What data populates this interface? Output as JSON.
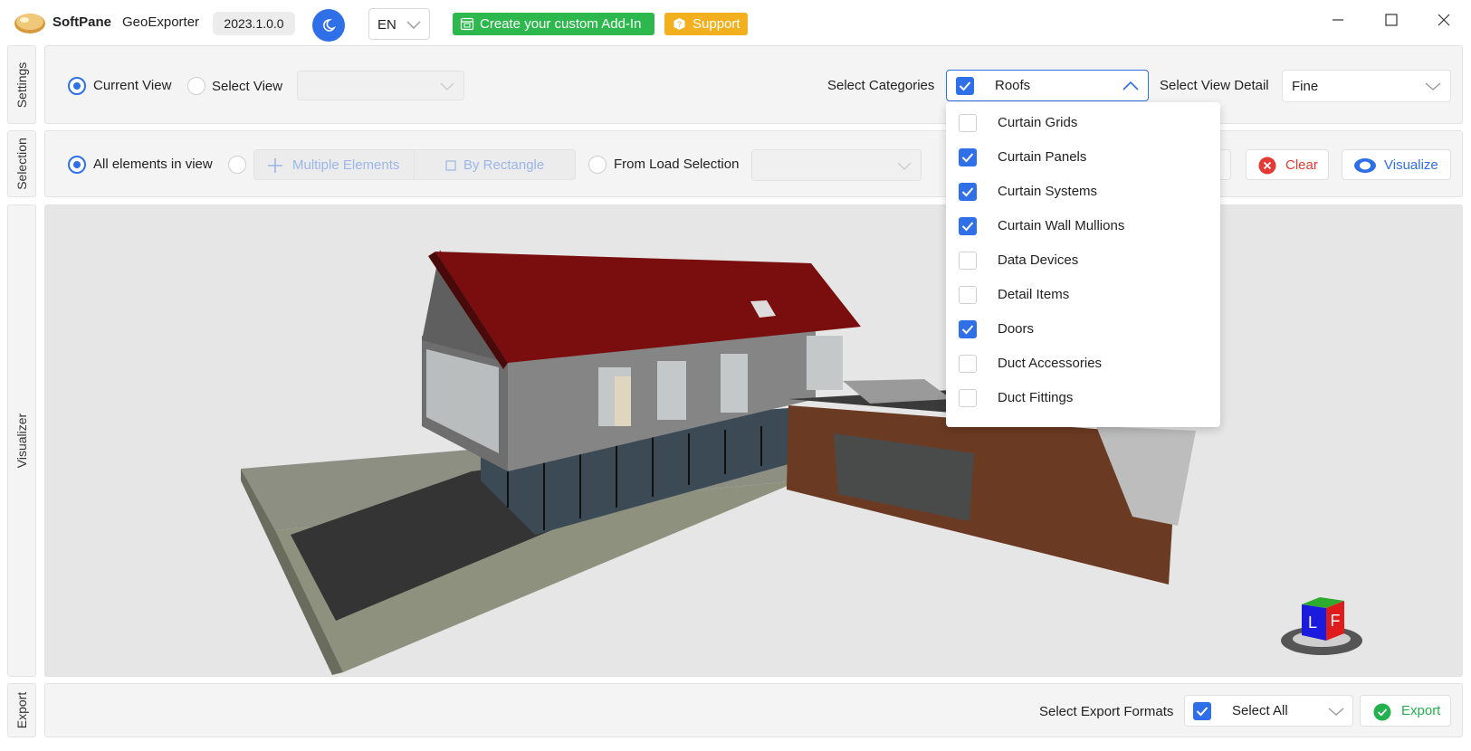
{
  "titlebar": {
    "brand": "SoftPane",
    "app_name": "GeoExporter",
    "version": "2023.1.0.0",
    "language": "EN",
    "addin_label": "Create your custom Add-In",
    "support_label": "Support"
  },
  "tabs": {
    "settings": "Settings",
    "selection": "Selection",
    "visualizer": "Visualizer",
    "export": "Export"
  },
  "settings": {
    "current_view_label": "Current View",
    "current_view_selected": true,
    "select_view_label": "Select View",
    "select_view_value": "",
    "categories_label": "Select Categories",
    "categories_value": "Roofs",
    "view_detail_label": "Select View Detail",
    "view_detail_value": "Fine"
  },
  "categories_menu": [
    {
      "label": "Curtain Grids",
      "checked": false
    },
    {
      "label": "Curtain Panels",
      "checked": true
    },
    {
      "label": "Curtain Systems",
      "checked": true
    },
    {
      "label": "Curtain Wall Mullions",
      "checked": true
    },
    {
      "label": "Data Devices",
      "checked": false
    },
    {
      "label": "Detail Items",
      "checked": false
    },
    {
      "label": "Doors",
      "checked": true
    },
    {
      "label": "Duct Accessories",
      "checked": false
    },
    {
      "label": "Duct Fittings",
      "checked": false
    }
  ],
  "selection": {
    "all_elements_label": "All elements in view",
    "multiple_elements_label": "Multiple Elements",
    "by_rectangle_label": "By Rectangle",
    "from_load_label": "From Load Selection",
    "clear_label": "Clear",
    "visualize_label": "Visualize"
  },
  "viewcube": {
    "left_face": "L",
    "front_face": "F"
  },
  "export": {
    "formats_label": "Select Export Formats",
    "formats_value": "Select All",
    "export_label": "Export"
  },
  "colors": {
    "accent": "#2f6fe8",
    "addin_green": "#2db84e",
    "support_yellow": "#f2b01e",
    "clear_red": "#e53935",
    "export_green": "#22b14c",
    "roof_red": "#7a0e0e"
  },
  "icons": [
    "app-logo-icon",
    "moon-icon",
    "calendar-icon",
    "support-icon",
    "minimize-icon",
    "maximize-icon",
    "close-icon",
    "chevron-down-icon",
    "chevron-up-icon",
    "check-icon",
    "plus-icon",
    "rectangle-icon",
    "clear-icon",
    "eye-icon",
    "export-check-icon"
  ]
}
